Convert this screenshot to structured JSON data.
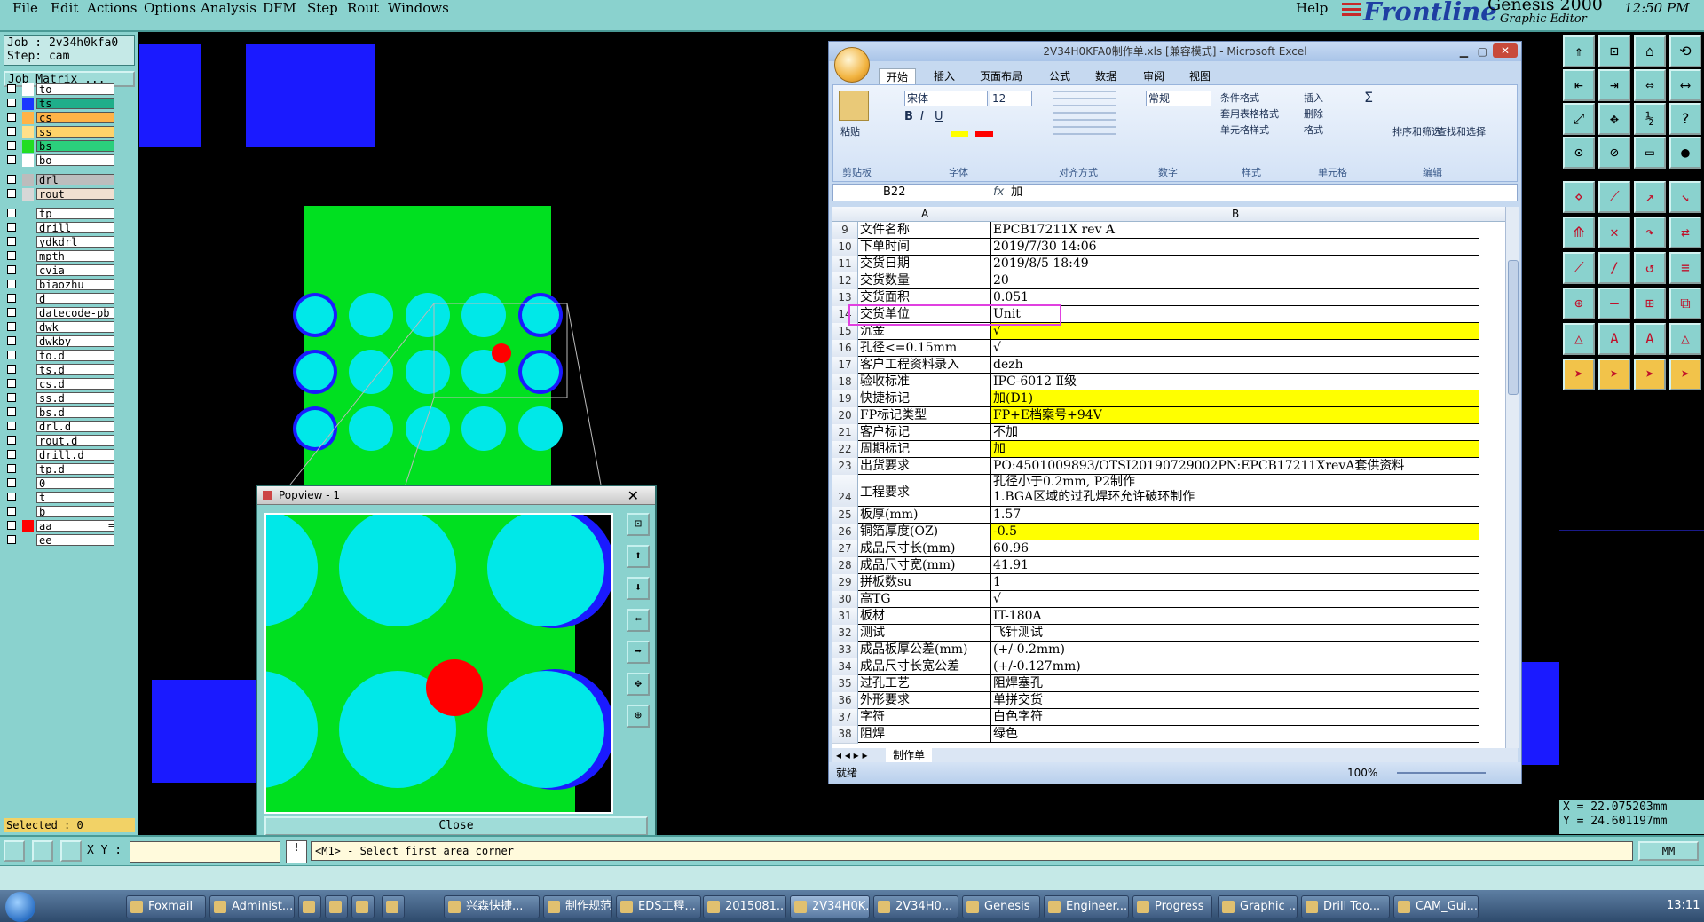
{
  "genesis": {
    "menus": [
      "File",
      "Edit",
      "Actions",
      "Options",
      "Analysis",
      "DFM",
      "Step",
      "Rout",
      "Windows"
    ],
    "help": "Help",
    "brand": "Frontline",
    "product": "Genesis 2000",
    "subtitle": "Graphic Editor",
    "clock": "12:50 PM",
    "job_label": "Job : 2v34h0kfa0",
    "step_label": "Step: cam",
    "job_matrix": "Job Matrix ...",
    "selected": "Selected : 0",
    "xy_label": "X Y :",
    "prompt": "<M1> - Select first area corner",
    "units": "MM",
    "coord_x": "X = 22.075203mm",
    "coord_y": "Y = 24.601197mm"
  },
  "layers": [
    {
      "name": "to",
      "color": "#ffffff"
    },
    {
      "name": "ts",
      "color": "#1a36ff",
      "bg": "#1fae8a"
    },
    {
      "name": "cs",
      "color": "#ffb347",
      "bg": "#ffb347"
    },
    {
      "name": "ss",
      "color": "#ffe08a",
      "bg": "#ffd36a"
    },
    {
      "name": "bs",
      "color": "#22dd22",
      "bg": "#2bcf7c"
    },
    {
      "name": "bo",
      "color": "#ffffff"
    },
    {
      "name": "drl",
      "color": "#bcbcbc",
      "bg": "#bdbdbd"
    },
    {
      "name": "rout",
      "color": "#d7d7d7",
      "bg": "#f0e0d0"
    },
    {
      "name": "tp",
      "color": "#8ad2ce"
    },
    {
      "name": "drill",
      "color": "#8ad2ce"
    },
    {
      "name": "ydkdrl",
      "color": "#8ad2ce"
    },
    {
      "name": "mpth",
      "color": "#8ad2ce"
    },
    {
      "name": "cvia",
      "color": "#8ad2ce"
    },
    {
      "name": "biaozhu",
      "color": "#8ad2ce"
    },
    {
      "name": "d",
      "color": "#8ad2ce"
    },
    {
      "name": "datecode-pb",
      "color": "#8ad2ce"
    },
    {
      "name": "dwk",
      "color": "#8ad2ce"
    },
    {
      "name": "dwkby",
      "color": "#8ad2ce"
    },
    {
      "name": "to.d",
      "color": "#8ad2ce"
    },
    {
      "name": "ts.d",
      "color": "#8ad2ce"
    },
    {
      "name": "cs.d",
      "color": "#8ad2ce"
    },
    {
      "name": "ss.d",
      "color": "#8ad2ce"
    },
    {
      "name": "bs.d",
      "color": "#8ad2ce"
    },
    {
      "name": "drl.d",
      "color": "#8ad2ce"
    },
    {
      "name": "rout.d",
      "color": "#8ad2ce"
    },
    {
      "name": "drill.d",
      "color": "#8ad2ce"
    },
    {
      "name": "tp.d",
      "color": "#8ad2ce"
    },
    {
      "name": "0",
      "color": "#8ad2ce"
    },
    {
      "name": "t",
      "color": "#8ad2ce"
    },
    {
      "name": "b",
      "color": "#8ad2ce"
    },
    {
      "name": "aa",
      "color": "#ff0000",
      "extra": "="
    },
    {
      "name": "ee",
      "color": "#8ad2ce"
    }
  ],
  "popview": {
    "title": "Popview - 1",
    "close": "Close"
  },
  "excel": {
    "title": "2V34H0KFA0制作单.xls [兼容模式] - Microsoft Excel",
    "tabs": [
      "开始",
      "插入",
      "页面布局",
      "公式",
      "数据",
      "审阅",
      "视图"
    ],
    "paste": "粘贴",
    "font_name": "宋体",
    "font_size": "12",
    "number_format": "常规",
    "ribbon_groups": [
      "剪贴板",
      "字体",
      "对齐方式",
      "数字",
      "样式",
      "单元格",
      "编辑"
    ],
    "style_buttons": [
      "条件格式",
      "套用表格格式",
      "单元格样式"
    ],
    "cell_buttons": [
      "插入",
      "删除",
      "格式"
    ],
    "edit_buttons": [
      "排序和筛选",
      "查找和选择"
    ],
    "name_box": "B22",
    "formula": "加",
    "col_a": "A",
    "col_b": "B",
    "rows": [
      {
        "n": "9",
        "a": "文件名称",
        "b": "EPCB17211X rev A"
      },
      {
        "n": "10",
        "a": "下单时间",
        "b": "2019/7/30 14:06"
      },
      {
        "n": "11",
        "a": "交货日期",
        "b": "2019/8/5 18:49"
      },
      {
        "n": "12",
        "a": "交货数量",
        "b": "20"
      },
      {
        "n": "13",
        "a": "交货面积",
        "b": "0.051"
      },
      {
        "n": "14",
        "a": "交货单位",
        "b": "Unit"
      },
      {
        "n": "15",
        "a": "沉金",
        "b": "√"
      },
      {
        "n": "16",
        "a": "孔径<=0.15mm",
        "b": "√"
      },
      {
        "n": "17",
        "a": "客户工程资料录入",
        "b": "dezh"
      },
      {
        "n": "18",
        "a": "验收标准",
        "b": "IPC-6012 Ⅱ级"
      },
      {
        "n": "19",
        "a": "快捷标记",
        "b": "加(D1)"
      },
      {
        "n": "20",
        "a": "FP标记类型",
        "b": "FP+E档案号+94V"
      },
      {
        "n": "21",
        "a": "客户标记",
        "b": "不加"
      },
      {
        "n": "22",
        "a": "周期标记",
        "b": "加"
      },
      {
        "n": "23",
        "a": "出货要求",
        "b": "PO:4501009893/OTSI20190729002PN:EPCB17211XrevA套供资料"
      },
      {
        "n": "24",
        "a": "工程要求",
        "b": "孔径小于0.2mm, P2制作",
        "b2": "1.BGA区域的过孔焊环允许破环制作"
      },
      {
        "n": "25",
        "a": "板厚(mm)",
        "b": "1.57"
      },
      {
        "n": "26",
        "a": "铜箔厚度(OZ)",
        "b": "-0.5"
      },
      {
        "n": "27",
        "a": "成品尺寸长(mm)",
        "b": "60.96"
      },
      {
        "n": "28",
        "a": "成品尺寸宽(mm)",
        "b": "41.91"
      },
      {
        "n": "29",
        "a": "拼板数su",
        "b": "1"
      },
      {
        "n": "30",
        "a": "高TG",
        "b": "√"
      },
      {
        "n": "31",
        "a": "板材",
        "b": "IT-180A"
      },
      {
        "n": "32",
        "a": "测试",
        "b": "飞针测试"
      },
      {
        "n": "33",
        "a": "成品板厚公差(mm)",
        "b": "(+/-0.2mm)"
      },
      {
        "n": "34",
        "a": "成品尺寸长宽公差",
        "b": "(+/-0.127mm)"
      },
      {
        "n": "35",
        "a": "过孔工艺",
        "b": "阻焊塞孔"
      },
      {
        "n": "36",
        "a": "外形要求",
        "b": "单拼交货"
      },
      {
        "n": "37",
        "a": "字符",
        "b": "白色字符"
      },
      {
        "n": "38",
        "a": "阻焊",
        "b": "绿色"
      }
    ],
    "sheet_tab": "制作单",
    "status": "就绪",
    "zoom": "100%"
  },
  "taskbar": [
    "Foxmail",
    "Administ...",
    "",
    "",
    "",
    "",
    "兴森快捷...",
    "制作规范 ...",
    "EDS工程...",
    "2015081...",
    "2V34H0K...",
    "2V34H0...",
    "Genesis",
    "Engineer...",
    "Progress",
    "Graphic ...",
    "Drill Too...",
    "CAM_Gui..."
  ],
  "tray_time": "13:11",
  "colors": {
    "genesis_bg": "#8ad2ce",
    "cu": "#00e020",
    "pad": "#00e8e8",
    "blue": "#1a1aff",
    "red": "#ff0000",
    "highlight": "#ffff00"
  }
}
